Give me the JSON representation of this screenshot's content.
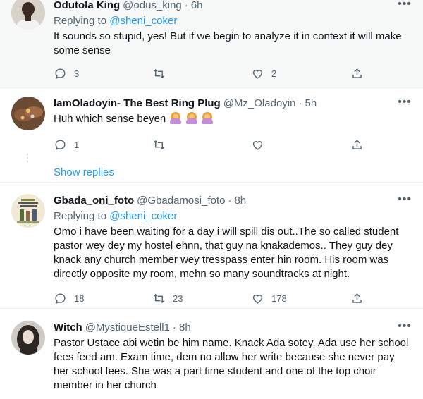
{
  "tweets": [
    {
      "name": "Odutola King",
      "handle": "@odus_king",
      "time": "6h",
      "replying_prefix": "Replying to",
      "replying_to": "@sheni_coker",
      "text": "It sounds so stupid, yes! But if we begin to analyze it in context it will make some sense",
      "reply_count": "3",
      "retweet_count": "",
      "like_count": "2",
      "avatar_icon": "person-avatar"
    },
    {
      "name": "IamOladoyin- The Best Ring Plug",
      "handle": "@Mz_Oladoyin",
      "time": "5h",
      "text": "Huh which sense beyen",
      "emoji": [
        "woman-shrugging-emoji",
        "woman-shrugging-emoji",
        "woman-shrugging-emoji"
      ],
      "reply_count": "1",
      "retweet_count": "",
      "like_count": "",
      "show_replies": "Show replies",
      "avatar_icon": "hands-rings-avatar"
    },
    {
      "name": "Gbada_oni_foto",
      "handle": "@Gbadamosi_foto",
      "time": "8h",
      "replying_prefix": "Replying to",
      "replying_to": "@sheni_coker",
      "text": "Omo i have been waiting for a day i will spill dis out..The so called student pastor wey dey my hostel ehnn, that guy na knakademos.. They guy dey knack any church member wey tresspass enter hin room. His room was directly opposite my room, mehn so many soundtracks at night.",
      "reply_count": "18",
      "retweet_count": "23",
      "like_count": "178",
      "avatar_icon": "poster-avatar"
    },
    {
      "name": "Witch",
      "handle": "@MystiqueEstell1",
      "time": "8h",
      "text": "Pastor Ustace abi wetin be him name. Knack Ada sotey, Ada use her school fees feed am. Exam time, dem no allow her write because she never pay her school fees. She was a part time student and one of the top choir member in her church",
      "avatar_icon": "woman-portrait-avatar"
    }
  ],
  "separator": "·",
  "more_icon": "more-dots-icon",
  "colors": {
    "accent": "#1d9bf0",
    "secondary_text": "#536471",
    "highlight_bg": "#f7f9f9",
    "divider": "#ebeef0"
  }
}
